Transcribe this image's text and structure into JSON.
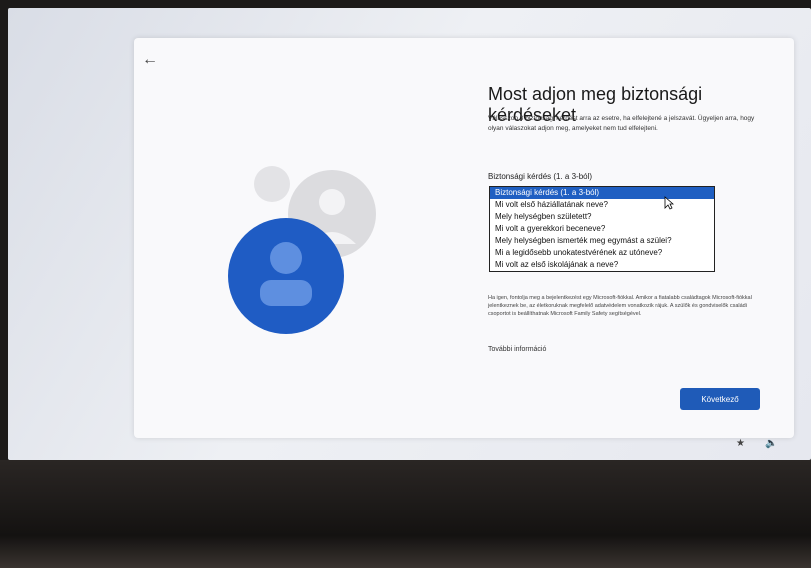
{
  "dialog": {
    "title": "Most adjon meg biztonsági kérdéseket",
    "description": "Válasszon 3 biztonsági kérdést arra az esetre, ha elfelejtené a jelszavát. Ügyeljen arra, hogy olyan válaszokat adjon meg, amelyeket nem tud elfelejteni.",
    "field_label": "Biztonsági kérdés (1. a 3-ból)",
    "dropdown_options": [
      "Biztonsági kérdés (1. a 3-ból)",
      "Mi volt első háziállatának neve?",
      "Mely helységben született?",
      "Mi volt a gyerekkori beceneve?",
      "Mely helységben ismerték meg egymást a szülei?",
      "Mi a legidősebb unokatestvérének az utóneve?",
      "Mi volt az első iskolájának a neve?"
    ],
    "selected_index": 0,
    "family_text": "Ha igen, fontolja meg a bejelentkezést egy Microsoft-fiókkal. Amikor a fiatalabb családtagok Microsoft-fiókkal jelentkeznek be, az életkoruknak megfelelő adatvédelem vonatkozik rájuk. A szülők és gondviselők családi csoportot is beállíthatnak Microsoft Family Safety segítségével.",
    "more_info": "További információ",
    "next_label": "Következő"
  },
  "icons": {
    "back": "back-arrow-icon",
    "accessibility": "accessibility-icon",
    "volume": "volume-icon"
  },
  "colors": {
    "accent": "#1f5bb8",
    "avatar_blue": "#1f5cc4"
  }
}
